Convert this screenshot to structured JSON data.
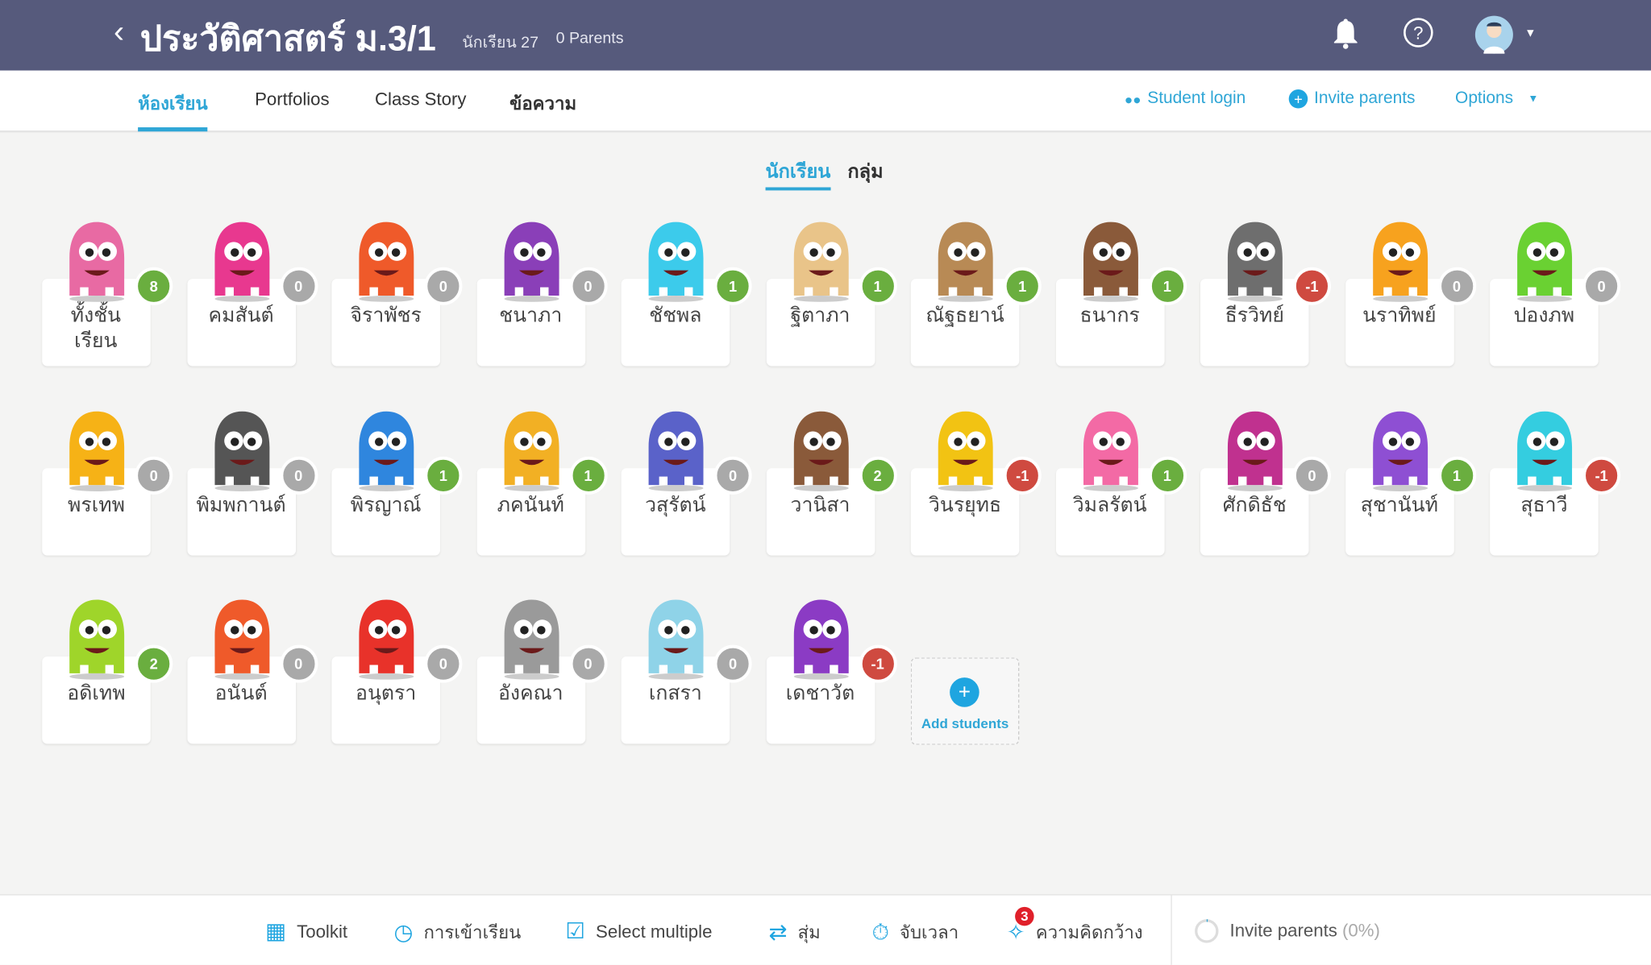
{
  "header": {
    "title": "ประวัติศาสตร์ ม.3/1",
    "student_count": "นักเรียน 27",
    "parents_count": "0 Parents",
    "back_icon": "chevron-left-icon",
    "bell_icon": "bell-icon",
    "help_icon": "help-icon",
    "bg_color": "#565a7c"
  },
  "nav": {
    "tabs": [
      {
        "label": "ห้องเรียน",
        "active": true
      },
      {
        "label": "Portfolios"
      },
      {
        "label": "Class Story"
      },
      {
        "label": "ข้อความ"
      }
    ],
    "student_login": "Student login",
    "invite_parents": "Invite parents",
    "options": "Options",
    "accent": "#2fa6d6"
  },
  "view_toggle": {
    "students": "นักเรียน",
    "groups": "กลุ่ม"
  },
  "students": [
    {
      "name": "ทั้งชั้นเรียน",
      "points": 8,
      "color": "#e86aa3"
    },
    {
      "name": "คมสันต์",
      "points": 0,
      "color": "#e8388f"
    },
    {
      "name": "จิราพัชร",
      "points": 0,
      "color": "#ef5a2a"
    },
    {
      "name": "ชนาภา",
      "points": 0,
      "color": "#8a3fb8"
    },
    {
      "name": "ชัชพล",
      "points": 1,
      "color": "#3ccbeb"
    },
    {
      "name": "ฐิตาภา",
      "points": 1,
      "color": "#e9c489"
    },
    {
      "name": "ณัฐธยาน์",
      "points": 1,
      "color": "#b88a55"
    },
    {
      "name": "ธนากร",
      "points": 1,
      "color": "#8a5a3a"
    },
    {
      "name": "ธีรวิทย์",
      "points": -1,
      "color": "#6e6e6e"
    },
    {
      "name": "นราทิพย์",
      "points": 0,
      "color": "#f7a21e"
    },
    {
      "name": "ปองภพ",
      "points": 0,
      "color": "#6ad132"
    },
    {
      "name": "พรเทพ",
      "points": 0,
      "color": "#f6b216"
    },
    {
      "name": "พิมพกานต์",
      "points": 0,
      "color": "#555555"
    },
    {
      "name": "พิรญาณ์",
      "points": 1,
      "color": "#2f86de"
    },
    {
      "name": "ภคนันท์",
      "points": 1,
      "color": "#f2b024"
    },
    {
      "name": "วสุรัตน์",
      "points": 0,
      "color": "#5a62c9"
    },
    {
      "name": "วานิสา",
      "points": 2,
      "color": "#8a5a3a"
    },
    {
      "name": "วินรยุทธ",
      "points": -1,
      "color": "#f2c313"
    },
    {
      "name": "วิมลรัตน์",
      "points": 1,
      "color": "#f36aa5"
    },
    {
      "name": "ศักดิธัช",
      "points": 0,
      "color": "#c0318f"
    },
    {
      "name": "สุชานันท์",
      "points": 1,
      "color": "#8e4fd3"
    },
    {
      "name": "สุธาวี",
      "points": -1,
      "color": "#34cde0"
    },
    {
      "name": "อดิเทพ",
      "points": 2,
      "color": "#9fd52a"
    },
    {
      "name": "อนันต์",
      "points": 0,
      "color": "#ef5a2a"
    },
    {
      "name": "อนุตรา",
      "points": 0,
      "color": "#e8322a"
    },
    {
      "name": "อังคณา",
      "points": 0,
      "color": "#9a9a9a"
    },
    {
      "name": "เกสรา",
      "points": 0,
      "color": "#8fd3e8"
    },
    {
      "name": "เดชาวัต",
      "points": -1,
      "color": "#8b3bc4"
    }
  ],
  "add_students": "Add students",
  "badge_colors": {
    "positive": "#6aae3f",
    "zero": "#a9a9a9",
    "negative": "#cf4a40"
  },
  "toolbar": {
    "items": [
      {
        "label": "Toolkit",
        "icon": "grid-icon"
      },
      {
        "label": "การเข้าเรียน",
        "icon": "clock-icon"
      },
      {
        "label": "Select multiple",
        "icon": "checkbox-icon"
      },
      {
        "label": "สุ่ม",
        "icon": "shuffle-icon"
      },
      {
        "label": "จับเวลา",
        "icon": "timer-icon"
      },
      {
        "label": "ความคิดกว้าง",
        "icon": "lightbulb-icon",
        "badge": "3"
      }
    ],
    "invite_parents": "Invite parents",
    "invite_percent": "(0%)"
  }
}
